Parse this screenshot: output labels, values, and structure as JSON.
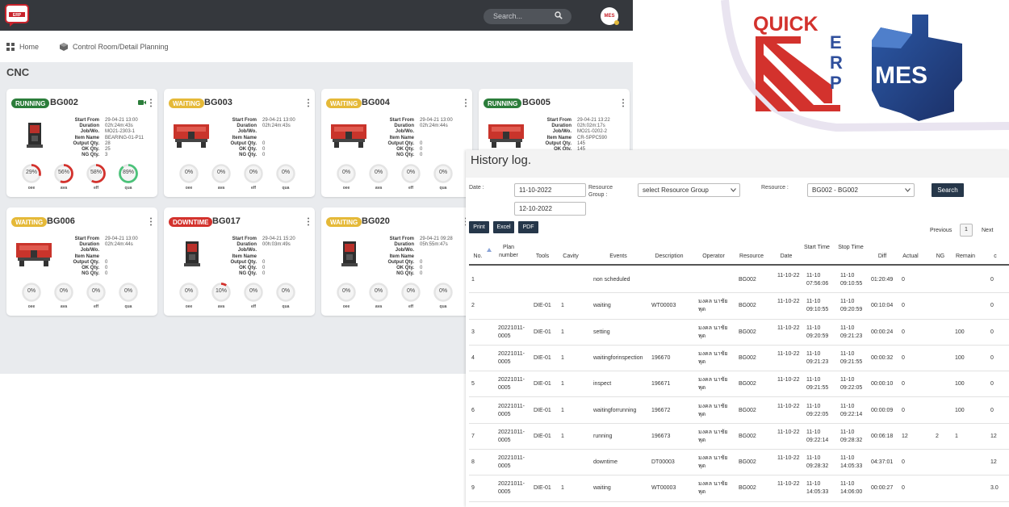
{
  "topbar": {
    "search_placeholder": "Search...",
    "avatar_text": "MES",
    "logo_text": "ERP"
  },
  "nav": {
    "home": "Home",
    "planning": "Control Room/Detail Planning"
  },
  "page_title": "CNC",
  "info_labels": [
    "Start From",
    "Duration",
    "Job/Wo.",
    "Item Name",
    "Output Qty.",
    "OK Qty.",
    "NG Qty."
  ],
  "gauge_labels": [
    "oee",
    "ava",
    "eff",
    "qua"
  ],
  "colors": {
    "running": "#2b7d3a",
    "waiting": "#e5b938",
    "downtime": "#d3322d",
    "gauge_red": "#d3322d",
    "gauge_green": "#4cc27a",
    "topbar": "#35383d",
    "button_dark": "#26374a"
  },
  "cards": [
    {
      "status": "RUNNING",
      "name": "BG002",
      "has_camera": true,
      "info": [
        "29-04-21 13:00",
        "02h:24m:43s",
        "MO21-2303-1",
        "BEARING-01-P11",
        "28",
        "25",
        "3"
      ],
      "gauges": [
        {
          "text": "29%",
          "value": 29,
          "color": "#d3322d"
        },
        {
          "text": "56%",
          "value": 56,
          "color": "#d3322d"
        },
        {
          "text": "58%",
          "value": 58,
          "color": "#d3322d"
        },
        {
          "text": "89%",
          "value": 89,
          "color": "#4cc27a"
        }
      ]
    },
    {
      "status": "WAITING",
      "name": "BG003",
      "has_camera": false,
      "info": [
        "29-04-21 13:00",
        "02h:24m:43s",
        "",
        "",
        "0",
        "0",
        "0"
      ],
      "gauges": [
        {
          "text": "0%",
          "value": 0,
          "color": "#d3322d"
        },
        {
          "text": "0%",
          "value": 0,
          "color": "#d3322d"
        },
        {
          "text": "0%",
          "value": 0,
          "color": "#d3322d"
        },
        {
          "text": "0%",
          "value": 0,
          "color": "#d3322d"
        }
      ]
    },
    {
      "status": "WAITING",
      "name": "BG004",
      "has_camera": false,
      "info": [
        "29-04-21 13:00",
        "02h:24m:44s",
        "",
        "",
        "0",
        "0",
        "0"
      ],
      "gauges": [
        {
          "text": "0%",
          "value": 0,
          "color": "#d3322d"
        },
        {
          "text": "0%",
          "value": 0,
          "color": "#d3322d"
        },
        {
          "text": "0%",
          "value": 0,
          "color": "#d3322d"
        },
        {
          "text": "0%",
          "value": 0,
          "color": "#d3322d"
        }
      ]
    },
    {
      "status": "RUNNING",
      "name": "BG005",
      "has_camera": false,
      "info": [
        "29-04-21 13:22",
        "02h:02m:17s",
        "MO21-0202-2",
        "CR-SPPC590",
        "145",
        "145",
        ""
      ],
      "gauges": []
    },
    {
      "status": "WAITING",
      "name": "BG006",
      "has_camera": false,
      "info": [
        "29-04-21 13:00",
        "02h:24m:44s",
        "",
        "",
        "0",
        "0",
        "0"
      ],
      "gauges": [
        {
          "text": "0%",
          "value": 0,
          "color": "#d3322d"
        },
        {
          "text": "0%",
          "value": 0,
          "color": "#d3322d"
        },
        {
          "text": "0%",
          "value": 0,
          "color": "#d3322d"
        },
        {
          "text": "0%",
          "value": 0,
          "color": "#d3322d"
        }
      ]
    },
    {
      "status": "DOWNTIME",
      "name": "BG017",
      "has_camera": false,
      "info": [
        "29-04-21 15:20",
        "00h:03m:49s",
        "",
        "",
        "0",
        "0",
        "0"
      ],
      "gauges": [
        {
          "text": "0%",
          "value": 0,
          "color": "#d3322d"
        },
        {
          "text": "10%",
          "value": 10,
          "color": "#d3322d"
        },
        {
          "text": "0%",
          "value": 0,
          "color": "#d3322d"
        },
        {
          "text": "0%",
          "value": 0,
          "color": "#d3322d"
        }
      ]
    },
    {
      "status": "WAITING",
      "name": "BG020",
      "has_camera": false,
      "info": [
        "29-04-21 09:28",
        "05h:55m:47s",
        "",
        "",
        "0",
        "0",
        "0"
      ],
      "gauges": [
        {
          "text": "0%",
          "value": 0,
          "color": "#d3322d"
        },
        {
          "text": "0%",
          "value": 0,
          "color": "#d3322d"
        },
        {
          "text": "0%",
          "value": 0,
          "color": "#d3322d"
        },
        {
          "text": "0%",
          "value": 0,
          "color": "#d3322d"
        }
      ]
    }
  ],
  "brand": {
    "quick": "QUICK",
    "erp_letters": [
      "E",
      "R",
      "P"
    ],
    "mes": "MES"
  },
  "history": {
    "title": "History log.",
    "date_label": "Date :",
    "date_from": "11-10-2022",
    "date_to": "12-10-2022",
    "resource_group_label": "Resource Group :",
    "resource_group_value": "select Resource Group",
    "resource_label": "Resource :",
    "resource_value": "BG002 - BG002",
    "search_button": "Search",
    "print_button": "Print",
    "excel_button": "Excel",
    "pdf_button": "PDF",
    "pager_previous": "Previous",
    "pager_current": "1",
    "pager_next": "Next",
    "columns": [
      "No.",
      "Plan number",
      "Tools",
      "Cavity",
      "Events",
      "Description",
      "Operator",
      "Resource",
      "Date",
      "Start Time",
      "Stop Time",
      "Diff",
      "Actual",
      "NG",
      "Remain",
      "c"
    ],
    "rows": [
      [
        "1",
        "",
        "",
        "",
        "non scheduled",
        "",
        "",
        "BG002",
        "11-10-22",
        "11-10 07:56:06",
        "11-10 09:10:55",
        "01:20:49",
        "0",
        "",
        "",
        "0"
      ],
      [
        "2",
        "",
        "DIE-01",
        "1",
        "waiting",
        "WT00003",
        "มงคล นาชัยพุด",
        "BG002",
        "11-10-22",
        "11-10 09:10:55",
        "11-10 09:20:59",
        "00:10:04",
        "0",
        "",
        "",
        "0"
      ],
      [
        "3",
        "20221011-0005",
        "DIE-01",
        "1",
        "setting",
        "",
        "มงคล นาชัยพุด",
        "BG002",
        "11-10-22",
        "11-10 09:20:59",
        "11-10 09:21:23",
        "00:00:24",
        "0",
        "",
        "100",
        "0"
      ],
      [
        "4",
        "20221011-0005",
        "DIE-01",
        "1",
        "waitingforinspection",
        "196670",
        "มงคล นาชัยพุด",
        "BG002",
        "11-10-22",
        "11-10 09:21:23",
        "11-10 09:21:55",
        "00:00:32",
        "0",
        "",
        "100",
        "0"
      ],
      [
        "5",
        "20221011-0005",
        "DIE-01",
        "1",
        "inspect",
        "196671",
        "มงคล นาชัยพุด",
        "BG002",
        "11-10-22",
        "11-10 09:21:55",
        "11-10 09:22:05",
        "00:00:10",
        "0",
        "",
        "100",
        "0"
      ],
      [
        "6",
        "20221011-0005",
        "DIE-01",
        "1",
        "waitingforrunning",
        "196672",
        "มงคล นาชัยพุด",
        "BG002",
        "11-10-22",
        "11-10 09:22:05",
        "11-10 09:22:14",
        "00:00:09",
        "0",
        "",
        "100",
        "0"
      ],
      [
        "7",
        "20221011-0005",
        "DIE-01",
        "1",
        "running",
        "196673",
        "มงคล นาชัยพุด",
        "BG002",
        "11-10-22",
        "11-10 09:22:14",
        "11-10 09:28:32",
        "00:06:18",
        "12",
        "2",
        "1",
        "12"
      ],
      [
        "8",
        "20221011-0005",
        "",
        "",
        "downtime",
        "DT00003",
        "มงคล นาชัยพุด",
        "BG002",
        "11-10-22",
        "11-10 09:28:32",
        "11-10 14:05:33",
        "04:37:01",
        "0",
        "",
        "",
        "12"
      ],
      [
        "9",
        "20221011-0005",
        "DIE-01",
        "1",
        "waiting",
        "WT00003",
        "มงคล นาชัยพุด",
        "BG002",
        "11-10-22",
        "11-10 14:05:33",
        "11-10 14:06:00",
        "00:00:27",
        "0",
        "",
        "",
        "3.0"
      ]
    ]
  }
}
